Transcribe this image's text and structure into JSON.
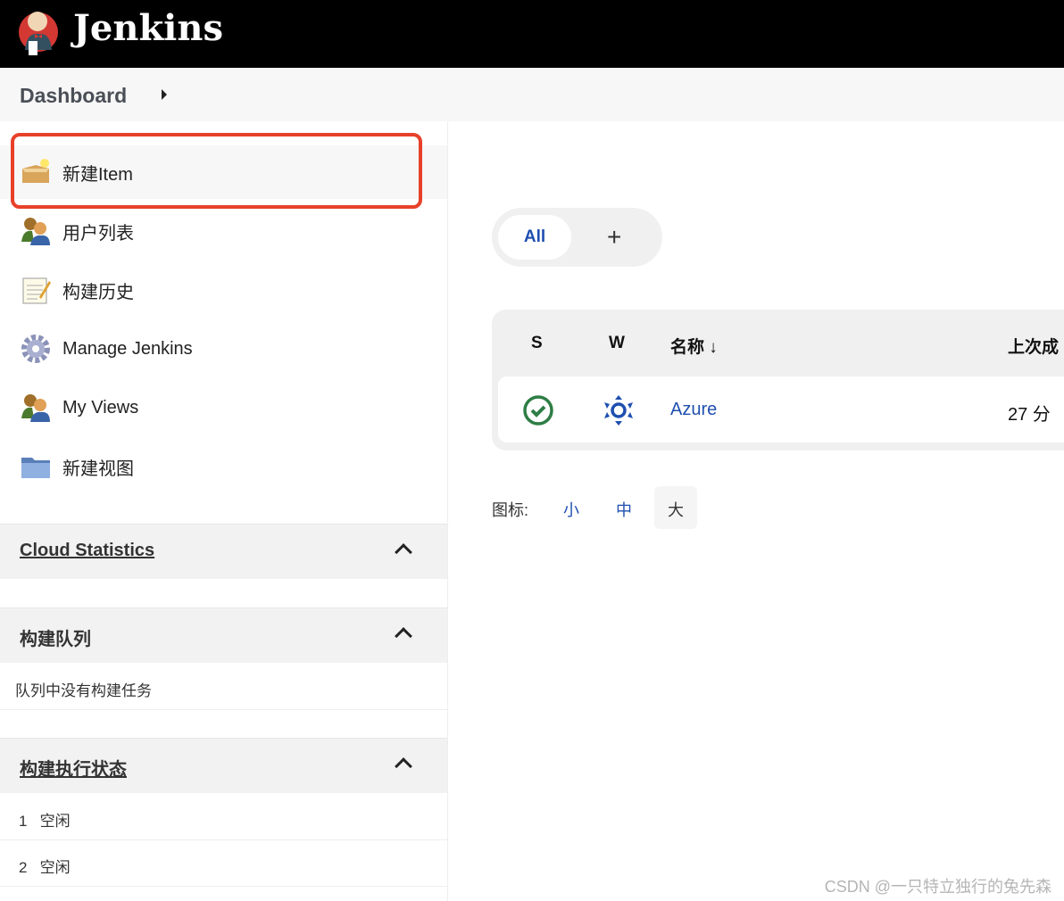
{
  "header": {
    "brand": "Jenkins"
  },
  "breadcrumb": {
    "items": [
      "Dashboard"
    ]
  },
  "sidebar": {
    "tasks": [
      {
        "label": "新建Item",
        "icon": "new-item-box-icon"
      },
      {
        "label": "用户列表",
        "icon": "users-icon"
      },
      {
        "label": "构建历史",
        "icon": "notepad-icon"
      },
      {
        "label": "Manage Jenkins",
        "icon": "gear-icon"
      },
      {
        "label": "My Views",
        "icon": "users-icon"
      },
      {
        "label": "新建视图",
        "icon": "folder-icon"
      }
    ],
    "cloud_statistics": {
      "title": "Cloud Statistics"
    },
    "build_queue": {
      "title": "构建队列",
      "empty": "队列中没有构建任务"
    },
    "executors": {
      "title": "构建执行状态",
      "rows": [
        {
          "num": "1",
          "status": "空闲"
        },
        {
          "num": "2",
          "status": "空闲"
        }
      ]
    }
  },
  "views": {
    "tabs": [
      "All"
    ],
    "add": "+"
  },
  "table": {
    "headers": {
      "s": "S",
      "w": "W",
      "name": "名称 ↓",
      "last_success": "上次成"
    },
    "rows": [
      {
        "status": "success",
        "weather": "sunny",
        "name": "Azure",
        "last_success": "27 分"
      }
    ]
  },
  "icon_size": {
    "label": "图标:",
    "options": [
      "小",
      "中",
      "大"
    ],
    "selected": "大"
  },
  "watermark": "CSDN @一只特立独行的兔先森",
  "colors": {
    "highlight": "#e8412a",
    "link": "#1f4fb0",
    "success": "#2e7d45"
  }
}
